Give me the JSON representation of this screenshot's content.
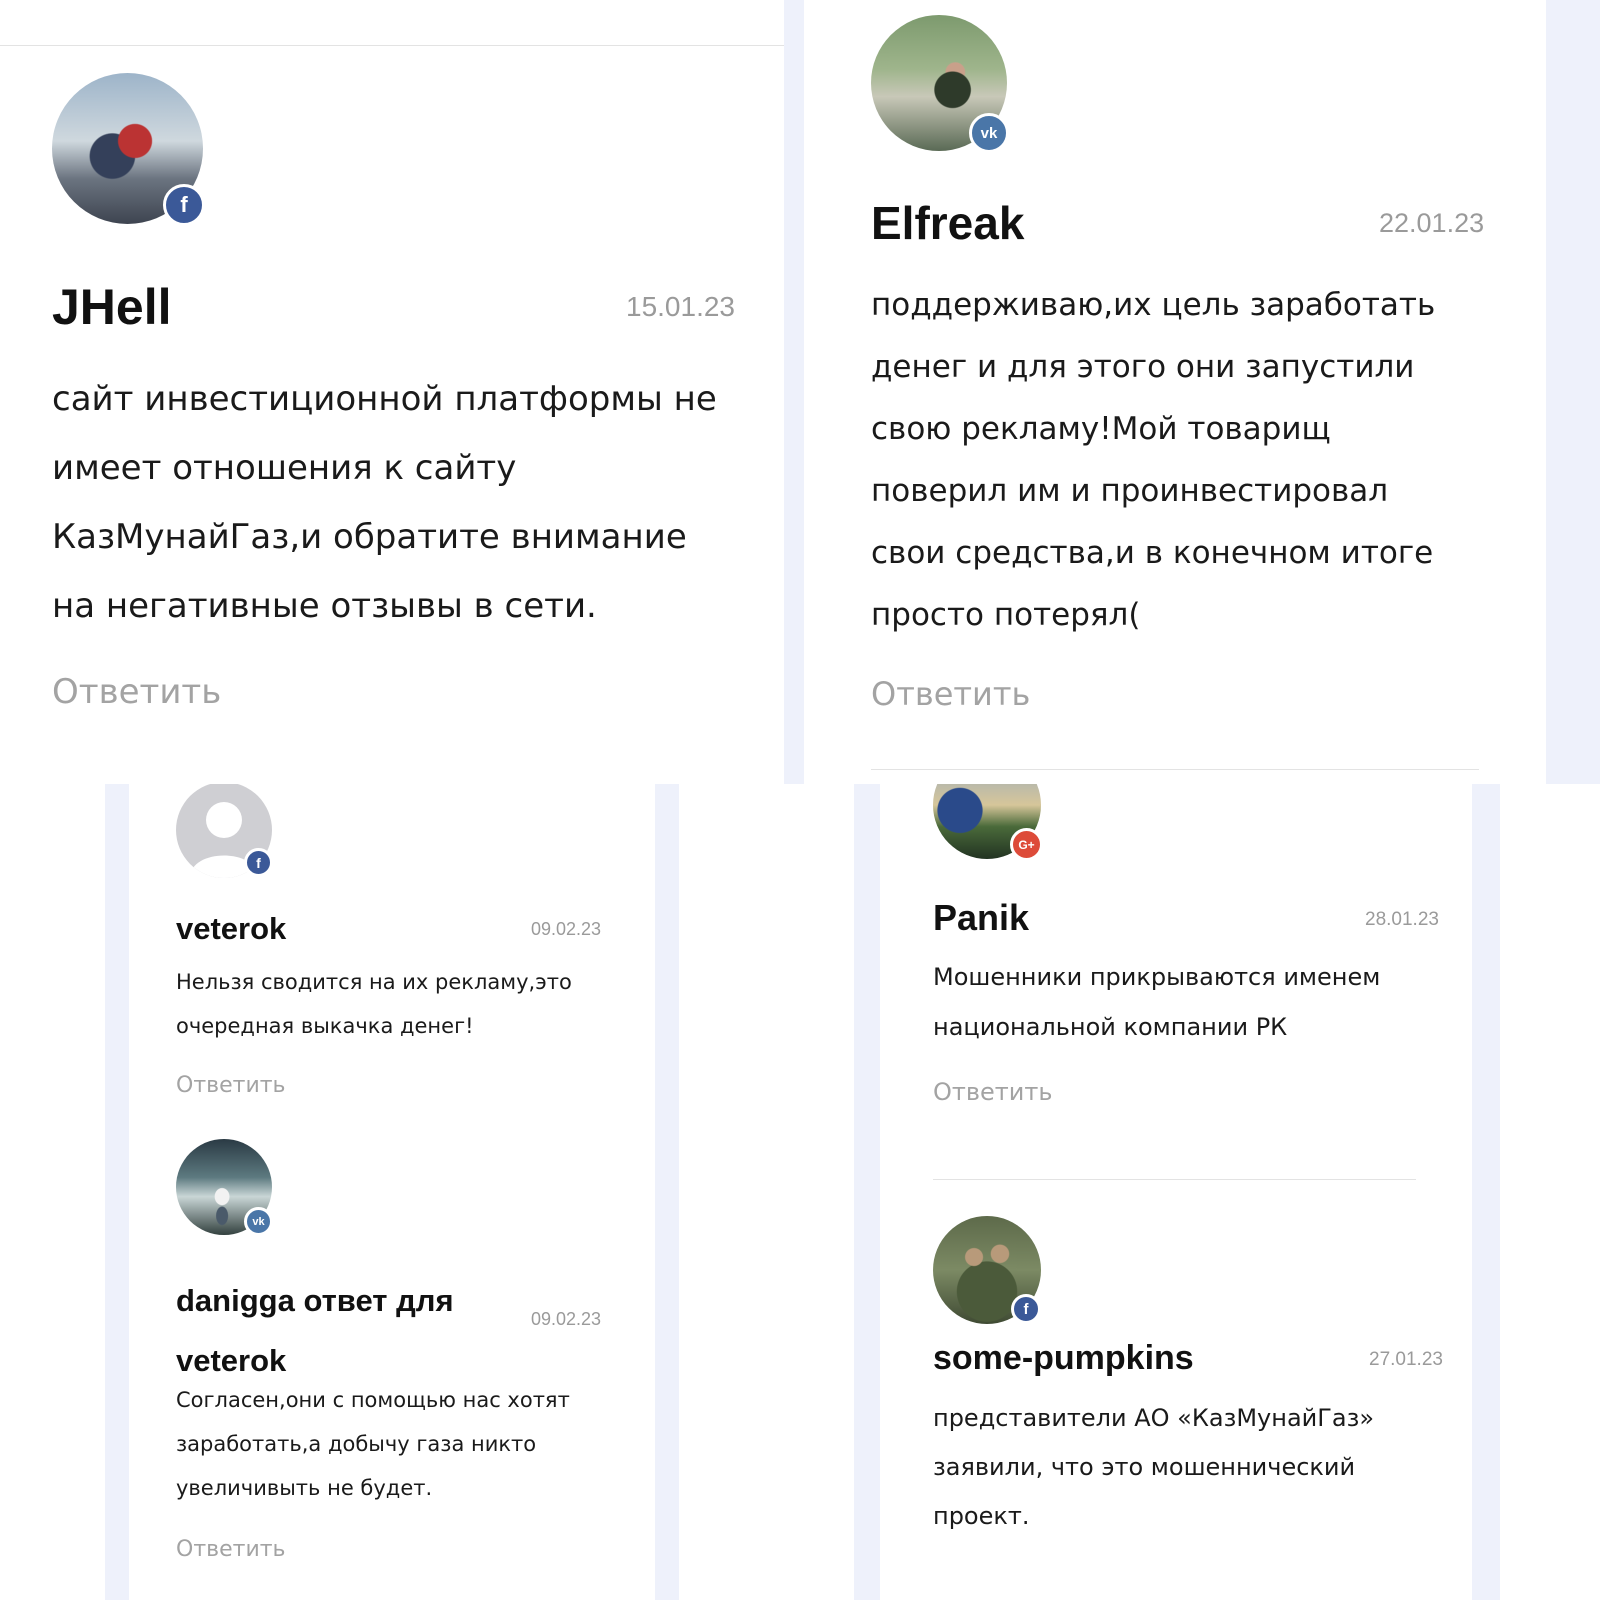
{
  "comments": {
    "jhell": {
      "author": "JHell",
      "date": "15.01.23",
      "lines": [
        "сайт инвестиционной платформы не",
        "имеет отношения к сайту",
        "КазМунайГаз,и обратите внимание",
        "на негативные отзывы в сети."
      ],
      "reply": "Ответить",
      "network": "facebook",
      "badge": "f"
    },
    "elfreak": {
      "author": "Elfreak",
      "date": "22.01.23",
      "lines": [
        "поддерживаю,их цель заработать",
        "денег и для этого они запустили",
        "свою рекламу!Мой товарищ",
        "поверил им и проинвестировал",
        "свои средства,и в конечном итоге",
        "просто потерял("
      ],
      "reply": "Ответить",
      "network": "vk",
      "badge": "vk"
    },
    "veterok": {
      "author": "veterok",
      "date": "09.02.23",
      "lines": [
        "Нельзя сводится на их рекламу,это",
        "очередная выкачка денег!"
      ],
      "reply": "Ответить",
      "network": "facebook",
      "badge": "f"
    },
    "danigga": {
      "author_line1": "danigga ответ для",
      "author_line2": "veterok",
      "date": "09.02.23",
      "lines": [
        "Согласен,они с помощью нас хотят",
        "заработать,а добычу газа никто",
        "увеличивыть не будет."
      ],
      "reply": "Ответить",
      "network": "vk",
      "badge": "vk"
    },
    "panik": {
      "author": "Panik",
      "date": "28.01.23",
      "lines": [
        "Мошенники прикрываются именем",
        "национальной компании РК"
      ],
      "reply": "Ответить",
      "network": "google-plus",
      "badge": "G+"
    },
    "pumpkins": {
      "author": "some-pumpkins",
      "date": "27.01.23",
      "lines": [
        "представители АО «КазМунайГаз»",
        "заявили, что это мошеннический",
        "проект."
      ],
      "network": "facebook",
      "badge": "f"
    }
  },
  "colors": {
    "facebook": "#3b5998",
    "vk": "#4a76a8",
    "google_plus": "#dd4b39",
    "stripe": "#eef1fb",
    "reply_text": "#a3a3a3",
    "date_text": "#9a9a9a"
  }
}
